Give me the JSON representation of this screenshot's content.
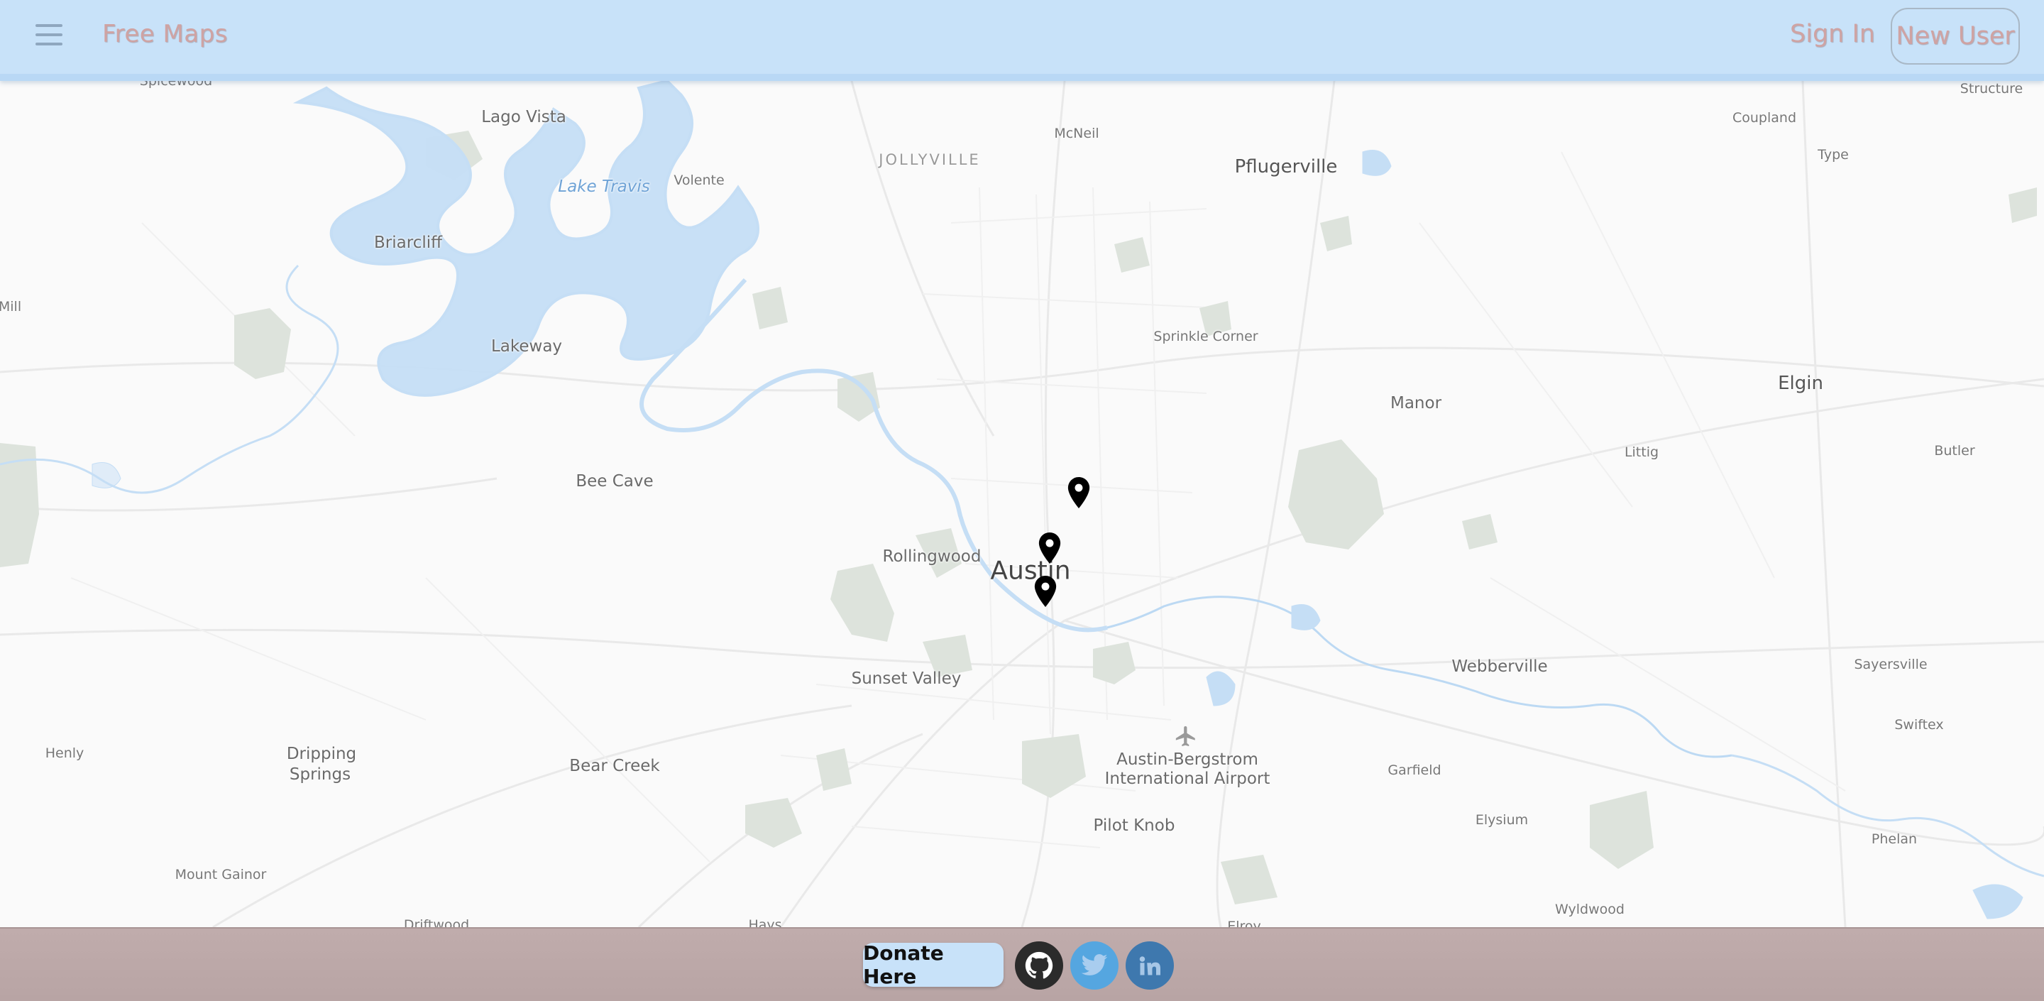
{
  "header": {
    "brand": "Free Maps",
    "sign_in": "Sign In",
    "new_user": "New User"
  },
  "map": {
    "places": [
      {
        "id": "spicewood",
        "label": "Spicewood"
      },
      {
        "id": "lago-vista",
        "label": "Lago Vista"
      },
      {
        "id": "jollyville",
        "label": "JOLLYVILLE"
      },
      {
        "id": "mcneil",
        "label": "McNeil"
      },
      {
        "id": "pflugerville",
        "label": "Pflugerville"
      },
      {
        "id": "structure",
        "label": "Structure"
      },
      {
        "id": "coupland",
        "label": "Coupland"
      },
      {
        "id": "type",
        "label": "Type"
      },
      {
        "id": "volente",
        "label": "Volente"
      },
      {
        "id": "lake-travis",
        "label": "Lake Travis"
      },
      {
        "id": "briarcliff",
        "label": "Briarcliff"
      },
      {
        "id": "mill",
        "label": "Mill"
      },
      {
        "id": "lakeway",
        "label": "Lakeway"
      },
      {
        "id": "sprinkle-corner",
        "label": "Sprinkle Corner"
      },
      {
        "id": "elgin",
        "label": "Elgin"
      },
      {
        "id": "manor",
        "label": "Manor"
      },
      {
        "id": "littig",
        "label": "Littig"
      },
      {
        "id": "butler",
        "label": "Butler"
      },
      {
        "id": "bee-cave",
        "label": "Bee Cave"
      },
      {
        "id": "rollingwood",
        "label": "Rollingwood"
      },
      {
        "id": "austin",
        "label": "Austin"
      },
      {
        "id": "webberville",
        "label": "Webberville"
      },
      {
        "id": "sayersville",
        "label": "Sayersville"
      },
      {
        "id": "sunset-valley",
        "label": "Sunset Valley"
      },
      {
        "id": "swiftex",
        "label": "Swiftex"
      },
      {
        "id": "henly",
        "label": "Henly"
      },
      {
        "id": "dripping-springs-1",
        "label": "Dripping"
      },
      {
        "id": "dripping-springs-2",
        "label": "Springs"
      },
      {
        "id": "bear-creek",
        "label": "Bear Creek"
      },
      {
        "id": "airport-1",
        "label": "Austin-Bergstrom"
      },
      {
        "id": "airport-2",
        "label": "International Airport"
      },
      {
        "id": "garfield",
        "label": "Garfield"
      },
      {
        "id": "elysium",
        "label": "Elysium"
      },
      {
        "id": "phelan",
        "label": "Phelan"
      },
      {
        "id": "pilot-knob",
        "label": "Pilot Knob"
      },
      {
        "id": "mount-gainor",
        "label": "Mount Gainor"
      },
      {
        "id": "wyldwood",
        "label": "Wyldwood"
      },
      {
        "id": "driftwood",
        "label": "Driftwood"
      },
      {
        "id": "hays",
        "label": "Hays"
      },
      {
        "id": "elroy",
        "label": "Elroy"
      }
    ],
    "markers": [
      {
        "id": "marker-1",
        "icon": "map-pin-icon"
      },
      {
        "id": "marker-2",
        "icon": "map-pin-icon"
      },
      {
        "id": "marker-3",
        "icon": "map-pin-icon"
      }
    ]
  },
  "footer": {
    "donate": "Donate Here",
    "social": [
      {
        "name": "github",
        "icon": "github-icon",
        "color": "#2b2b2b"
      },
      {
        "name": "twitter",
        "icon": "twitter-icon",
        "color": "#55a6e0"
      },
      {
        "name": "linkedin",
        "icon": "linkedin-icon",
        "color": "#3e78ae"
      }
    ]
  },
  "colors": {
    "header_bg": "#c8e2f9",
    "footer_bg": "#c0acac",
    "brand_text": "#cfa3a3",
    "water": "#c5def5",
    "park": "#dde3dc"
  }
}
